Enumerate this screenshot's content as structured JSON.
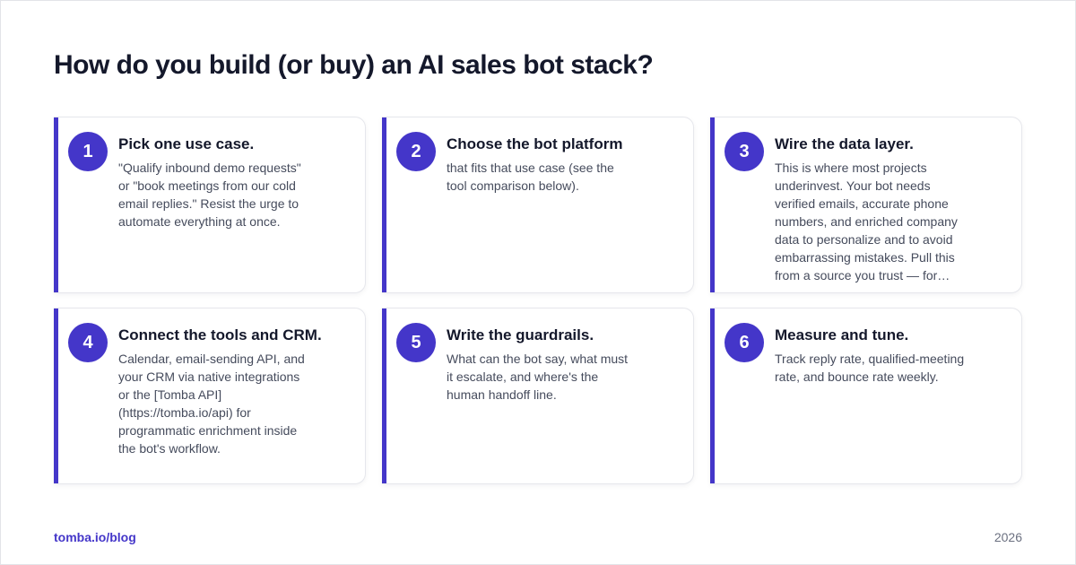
{
  "header": {
    "title": "How do you build (or buy) an AI sales bot stack?"
  },
  "cards": [
    {
      "number": "1",
      "title": "Pick one use case.",
      "body": "\"Qualify inbound demo requests\" or \"book meetings from our cold email replies.\" Resist the urge to automate everything at once."
    },
    {
      "number": "2",
      "title": "Choose the bot platform",
      "body": "that fits that use case (see the tool comparison below)."
    },
    {
      "number": "3",
      "title": "Wire the data layer.",
      "body": "This is where most projects underinvest. Your bot needs verified emails, accurate phone numbers, and enriched company data to personalize and to avoid embarrassing mistakes. Pull this from a source you trust — for…"
    },
    {
      "number": "4",
      "title": "Connect the tools and CRM.",
      "body": "Calendar, email-sending API, and your CRM via native integrations or the [Tomba API](https://tomba.io/api) for programmatic enrichment inside the bot's workflow."
    },
    {
      "number": "5",
      "title": "Write the guardrails.",
      "body": "What can the bot say, what must it escalate, and where's the human handoff line."
    },
    {
      "number": "6",
      "title": "Measure and tune.",
      "body": "Track reply rate, qualified-meeting rate, and bounce rate weekly."
    }
  ],
  "footer": {
    "brand": "tomba.io/blog",
    "year": "2026"
  },
  "colors": {
    "accent": "#4436c9",
    "title_text": "#14182b",
    "body_text": "#454b5c",
    "muted_text": "#6b7080"
  }
}
